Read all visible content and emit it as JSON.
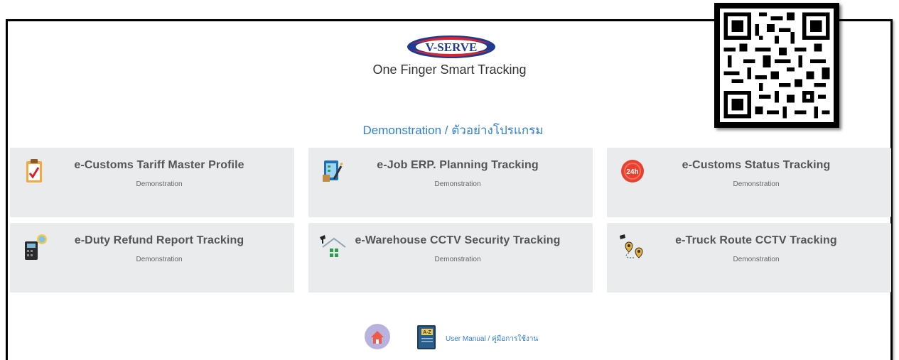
{
  "brand": {
    "logo_text": "V-SERVE",
    "tagline": "One Finger Smart Tracking"
  },
  "section_title": "Demonstration / ตัวอย่างโปรแกรม",
  "cards": [
    {
      "title": "e-Customs Tariff Master Profile",
      "subtitle": "Demonstration",
      "icon": "clipboard-check-icon"
    },
    {
      "title": "e-Job ERP. Planning Tracking",
      "subtitle": "Demonstration",
      "icon": "planning-board-icon"
    },
    {
      "title": "e-Customs Status Tracking",
      "subtitle": "Demonstration",
      "icon": "24h-clock-icon"
    },
    {
      "title": "e-Duty Refund Report Tracking",
      "subtitle": "Demonstration",
      "icon": "calculator-coin-icon"
    },
    {
      "title": "e-Warehouse CCTV Security Tracking",
      "subtitle": "Demonstration",
      "icon": "warehouse-camera-icon"
    },
    {
      "title": "e-Truck Route CCTV Tracking",
      "subtitle": "Demonstration",
      "icon": "route-pins-icon"
    }
  ],
  "footer": {
    "manual_label": "User Manual / คู่มือการใช้งาน",
    "manual_icon_text": "A-Z"
  },
  "colors": {
    "accent": "#2e7fd6",
    "card_bg": "#e9ebed",
    "logo_blue": "#1f3a93",
    "logo_red": "#d9232d"
  }
}
